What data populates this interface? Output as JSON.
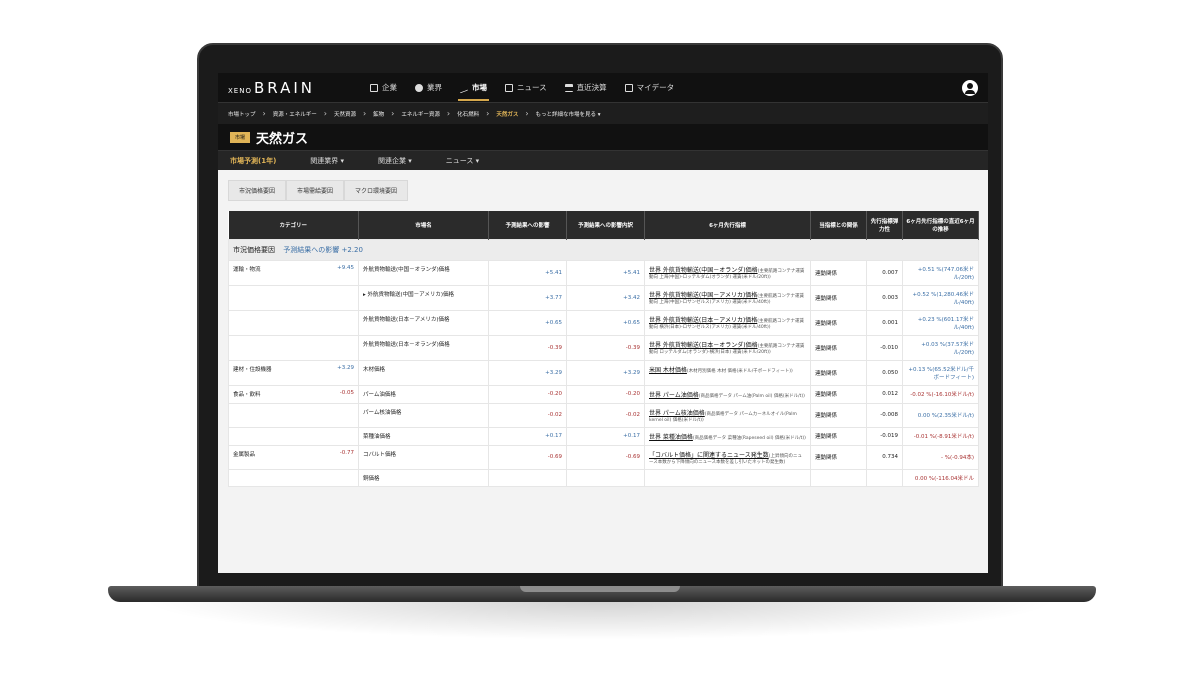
{
  "logo": {
    "small": "XENO",
    "big": "BRAIN"
  },
  "nav": [
    {
      "label": "企業",
      "icon": "building-icon",
      "active": false
    },
    {
      "label": "業界",
      "icon": "pie-chart-icon",
      "active": false
    },
    {
      "label": "市場",
      "icon": "trend-line-icon",
      "active": true
    },
    {
      "label": "ニュース",
      "icon": "newspaper-icon",
      "active": false
    },
    {
      "label": "直近決算",
      "icon": "bank-icon",
      "active": false
    },
    {
      "label": "マイデータ",
      "icon": "folder-icon",
      "active": false
    }
  ],
  "breadcrumb": [
    "市場トップ",
    "資源・エネルギー",
    "天然資源",
    "鉱物",
    "エネルギー資源",
    "化石燃料",
    "天然ガス",
    "もっと詳細な市場を見る ▾"
  ],
  "title": {
    "badge": "市場",
    "name": "天然ガス"
  },
  "tabs": [
    "市場予測(1年)",
    "関連業界 ▾",
    "関連企業 ▾",
    "ニュース ▾"
  ],
  "subtabs": [
    "市況価格要因",
    "市場需給要因",
    "マクロ環境要因"
  ],
  "headers": [
    "カテゴリー",
    "市場名",
    "予測結果への影響",
    "予測結果への影響内訳",
    "6ヶ月先行指標",
    "当指標との関係",
    "先行指標弾力性",
    "6ヶ月先行指標の直近6ヶ月の推移"
  ],
  "group": {
    "name": "市況価格要因",
    "impact_label": "予測結果への影響",
    "impact": "+2.20"
  },
  "rows": [
    {
      "category": "運輸・物流",
      "cat_value": "+9.45",
      "market": "外航貨物輸送(中国－オランダ)価格",
      "impact": "+5.41",
      "breakdown": "+5.41",
      "indicator": "世界 外航貨物輸送(中国－オランダ)価格",
      "desc": "(主要航路コンテナ運賃動向 上海(中国)-ロッテルダム(オランダ) 運賃(米ドル/20ft))",
      "relation": "連動関係",
      "elasticity": "0.007",
      "trend": "+0.51 %(747.06米ドル/20ft)",
      "trend_sign": "pos"
    },
    {
      "category": "",
      "cat_value": "",
      "market": "▸ 外航貨物輸送(中国－アメリカ)価格",
      "impact": "+3.77",
      "breakdown": "+3.42",
      "indicator": "世界 外航貨物輸送(中国－アメリカ)価格",
      "desc": "(主要航路コンテナ運賃動向 上海(中国)-ロサンゼルス(アメリカ) 運賃(米ドル/40ft))",
      "relation": "連動関係",
      "elasticity": "0.003",
      "trend": "+0.52 %(1,280.46米ドル/40ft)",
      "trend_sign": "pos"
    },
    {
      "category": "",
      "cat_value": "",
      "market": "外航貨物輸送(日本－アメリカ)価格",
      "impact": "+0.65",
      "breakdown": "+0.65",
      "indicator": "世界 外航貨物輸送(日本－アメリカ)価格",
      "desc": "(主要航路コンテナ運賃動向 横浜(日本)-ロサンゼルス(アメリカ) 運賃(米ドル/40ft))",
      "relation": "連動関係",
      "elasticity": "0.001",
      "trend": "+0.23 %(601.17米ドル/40ft)",
      "trend_sign": "pos"
    },
    {
      "category": "",
      "cat_value": "",
      "market": "外航貨物輸送(日本－オランダ)価格",
      "impact": "-0.39",
      "breakdown": "-0.39",
      "indicator": "世界 外航貨物輸送(日本－オランダ)価格",
      "desc": "(主要航路コンテナ運賃動向 ロッテルダム(オランダ)-横浜(日本) 運賃(米ドル/20ft))",
      "relation": "連動関係",
      "elasticity": "-0.010",
      "trend": "+0.03 %(37.57米ドル/20ft)",
      "trend_sign": "pos"
    },
    {
      "category": "建材・住設機器",
      "cat_value": "+3.29",
      "market": "木材価格",
      "impact": "+3.29",
      "breakdown": "+3.29",
      "indicator": "米国 木材価格",
      "desc": "(木材月別価格 木材 価格(米ドル/千ボードフィート))",
      "relation": "連動関係",
      "elasticity": "0.050",
      "trend": "+0.13 %(65.52米ドル/千ボードフィート)",
      "trend_sign": "pos"
    },
    {
      "category": "食品・飲料",
      "cat_value": "-0.05",
      "market": "パーム油価格",
      "impact": "-0.20",
      "breakdown": "-0.20",
      "indicator": "世界 パーム油価格",
      "desc": "(商品価格データ パーム油(Palm oil) 価格(米ドル/t))",
      "relation": "連動関係",
      "elasticity": "0.012",
      "trend": "-0.02 %(-16.10米ドル/t)",
      "trend_sign": "neg"
    },
    {
      "category": "",
      "cat_value": "",
      "market": "パーム核油価格",
      "impact": "-0.02",
      "breakdown": "-0.02",
      "indicator": "世界 パーム核油価格",
      "desc": "(商品価格データ パームカーネルオイル(Palm kernel oil) 価格(米ドル/t))",
      "relation": "連動関係",
      "elasticity": "-0.008",
      "trend": "0.00 %(2.35米ドル/t)",
      "trend_sign": "pos"
    },
    {
      "category": "",
      "cat_value": "",
      "market": "菜種油価格",
      "impact": "+0.17",
      "breakdown": "+0.17",
      "indicator": "世界 菜種油価格",
      "desc": "(商品価格データ 菜種油(Rapeseed oil) 価格(米ドル/t))",
      "relation": "連動関係",
      "elasticity": "-0.019",
      "trend": "-0.01 %(-8.91米ドル/t)",
      "trend_sign": "neg"
    },
    {
      "category": "金属製品",
      "cat_value": "-0.77",
      "market": "コバルト価格",
      "impact": "-0.69",
      "breakdown": "-0.69",
      "indicator": "「コバルト価格」に関連するニュース発生数",
      "desc": "(上昇傾向のニュース本数から下降傾向のニュース本数を差し引いたネットの発生数)",
      "relation": "連動関係",
      "elasticity": "0.734",
      "trend": "- %(-0.94本)",
      "trend_sign": "neg"
    },
    {
      "category": "",
      "cat_value": "",
      "market": "銅価格",
      "impact": "",
      "breakdown": "",
      "indicator": "",
      "desc": "",
      "relation": "",
      "elasticity": "",
      "trend": "0.00 %(-116.04米ドル",
      "trend_sign": "neg"
    }
  ]
}
